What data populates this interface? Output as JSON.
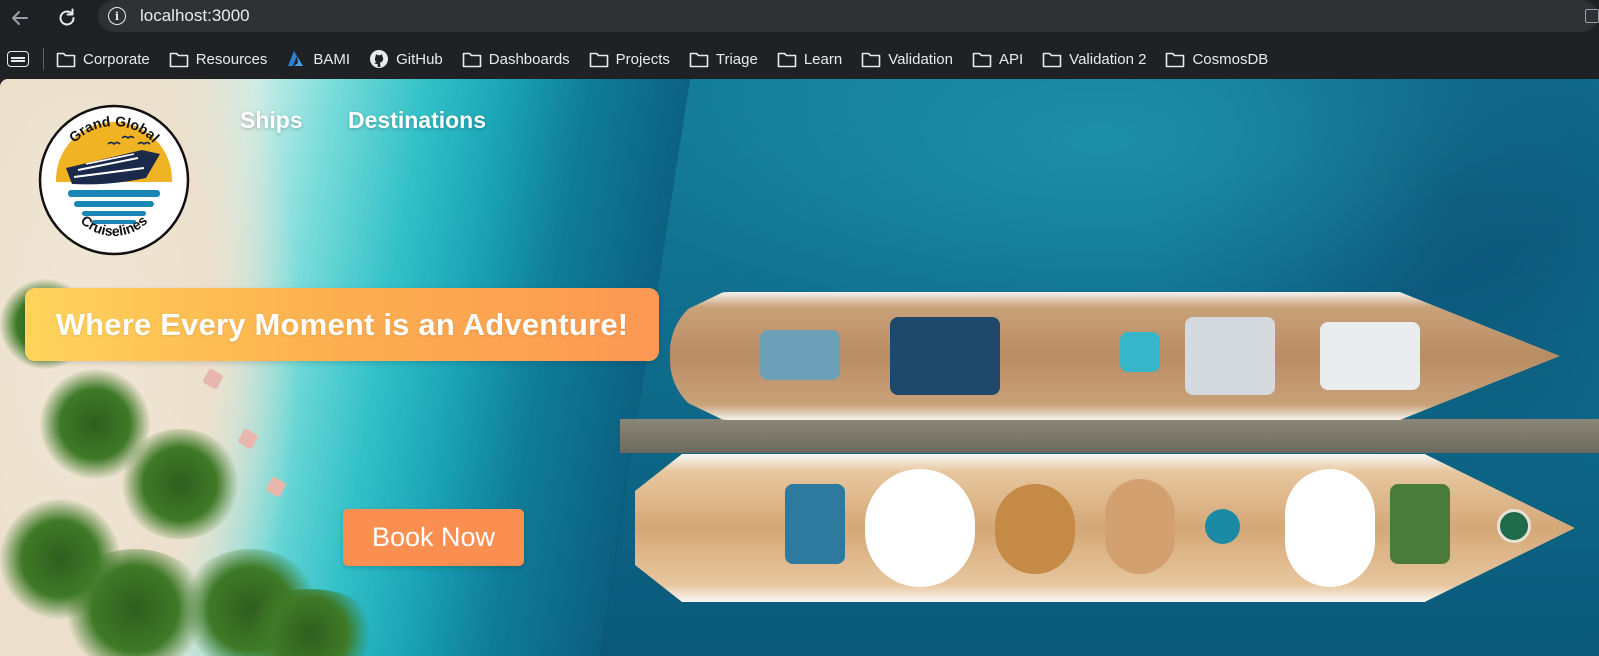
{
  "browser": {
    "url": "localhost:3000",
    "bookmarks": [
      {
        "label": "Corporate",
        "icon": "folder-icon"
      },
      {
        "label": "Resources",
        "icon": "folder-icon"
      },
      {
        "label": "BAMI",
        "icon": "azure-icon"
      },
      {
        "label": "GitHub",
        "icon": "github-icon"
      },
      {
        "label": "Dashboards",
        "icon": "folder-icon"
      },
      {
        "label": "Projects",
        "icon": "folder-icon"
      },
      {
        "label": "Triage",
        "icon": "folder-icon"
      },
      {
        "label": "Learn",
        "icon": "folder-icon"
      },
      {
        "label": "Validation",
        "icon": "folder-icon"
      },
      {
        "label": "API",
        "icon": "folder-icon"
      },
      {
        "label": "Validation 2",
        "icon": "folder-icon"
      },
      {
        "label": "CosmosDB",
        "icon": "folder-icon"
      }
    ]
  },
  "site": {
    "logo": {
      "top_text": "Grand Global",
      "bottom_text": "Cruiselines"
    },
    "nav": {
      "ships": "Ships",
      "destinations": "Destinations"
    },
    "hero": {
      "tagline": "Where Every Moment is an Adventure!",
      "cta": "Book Now"
    },
    "colors": {
      "cta": "#fb8f52",
      "tagline_start": "#fed45b",
      "tagline_end": "#fb9852",
      "logo_gold": "#f0b323",
      "logo_navy": "#1b2a4a",
      "logo_blue": "#1a86b5"
    }
  }
}
